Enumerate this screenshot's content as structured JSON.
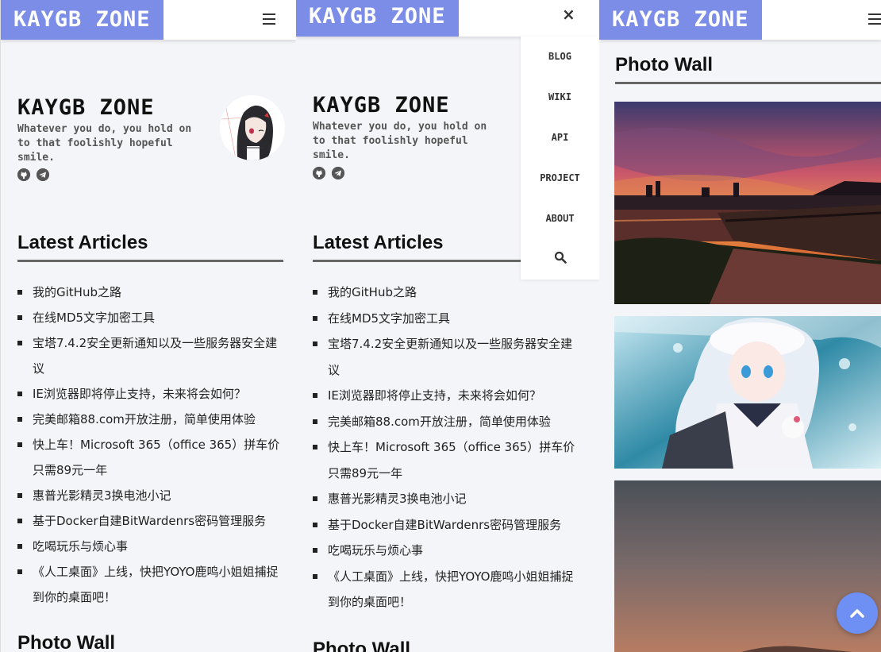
{
  "site": {
    "logo": "KAYGB ZONE",
    "hero_title": "KAYGB ZONE",
    "tagline": "Whatever you do, you hold on to that foolishly hopeful smile."
  },
  "icons": {
    "github": "github-icon",
    "telegram": "telegram-icon",
    "menu": "menu-icon",
    "close": "close-icon",
    "search": "search-icon",
    "scroll_top": "chevron-up-icon"
  },
  "nav": {
    "close_label": "×",
    "items": [
      {
        "label": "BLOG"
      },
      {
        "label": "WIKI"
      },
      {
        "label": "API"
      },
      {
        "label": "PROJECT"
      },
      {
        "label": "ABOUT"
      }
    ]
  },
  "latest": {
    "title": "Latest Articles",
    "items": [
      {
        "title": "我的GitHub之路"
      },
      {
        "title": "在线MD5文字加密工具"
      },
      {
        "title": "宝塔7.4.2安全更新通知以及一些服务器安全建议"
      },
      {
        "title": "IE浏览器即将停止支持，未来将会如何？"
      },
      {
        "title": "完美邮箱88.com开放注册，简单使用体验"
      },
      {
        "title": "快上车！Microsoft 365（office 365）拼车价只需89元一年"
      },
      {
        "title": "惠普光影精灵3换电池小记"
      },
      {
        "title": "基于Docker自建BitWardenrs密码管理服务"
      },
      {
        "title": "吃喝玩乐与烦心事"
      },
      {
        "title": "《人工桌面》上线，快把YOYO鹿鸣小姐姐捕捉到你的桌面吧！"
      }
    ]
  },
  "photo_wall": {
    "title": "Photo Wall"
  },
  "colors": {
    "accent": "#7b8de6",
    "background": "#f4f5f9",
    "fab": "#6e8ff3"
  }
}
